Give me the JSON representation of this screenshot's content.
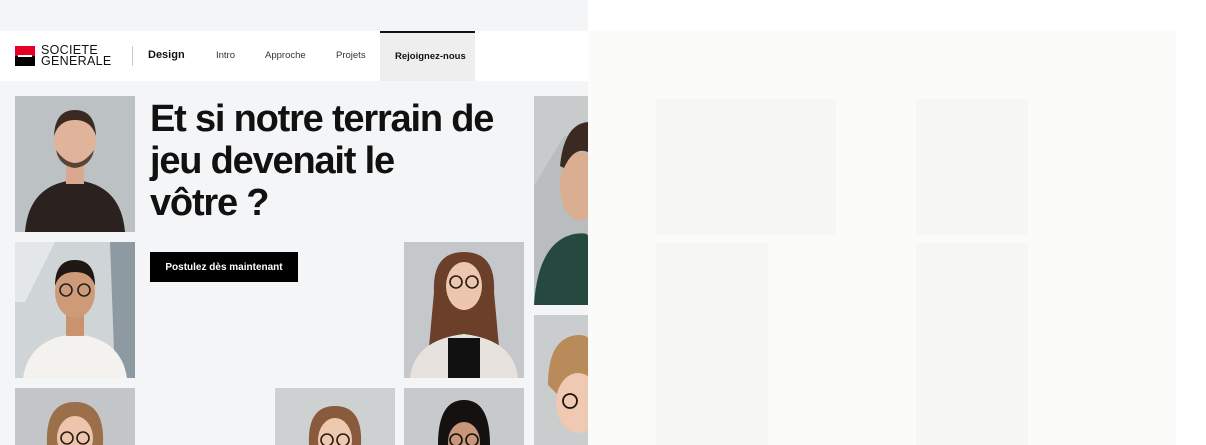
{
  "brand": {
    "logo_line1": "SOCIETE",
    "logo_line2": "GENERALE",
    "section": "Design"
  },
  "nav": {
    "intro": "Intro",
    "approche": "Approche",
    "projets": "Projets",
    "rejoignez": "Rejoignez-nous"
  },
  "hero": {
    "line1": "Et si notre terrain de",
    "line2": "jeu devenait le",
    "line3": "vôtre ?",
    "cta": "Postulez dès maintenant"
  },
  "colors": {
    "brand_red": "#e60028",
    "brand_black": "#000000",
    "page_bg": "#f4f5f7"
  },
  "photos": [
    {
      "name": "photo-portrait-man-beard"
    },
    {
      "name": "photo-portrait-man-glasses"
    },
    {
      "name": "photo-portrait-woman-glasses"
    },
    {
      "name": "photo-portrait-man-dark-shirt"
    },
    {
      "name": "photo-portrait-person-blonde"
    },
    {
      "name": "photo-portrait-woman-bottom-left"
    },
    {
      "name": "photo-portrait-woman-bottom-center"
    },
    {
      "name": "photo-portrait-person-bottom-right"
    }
  ]
}
